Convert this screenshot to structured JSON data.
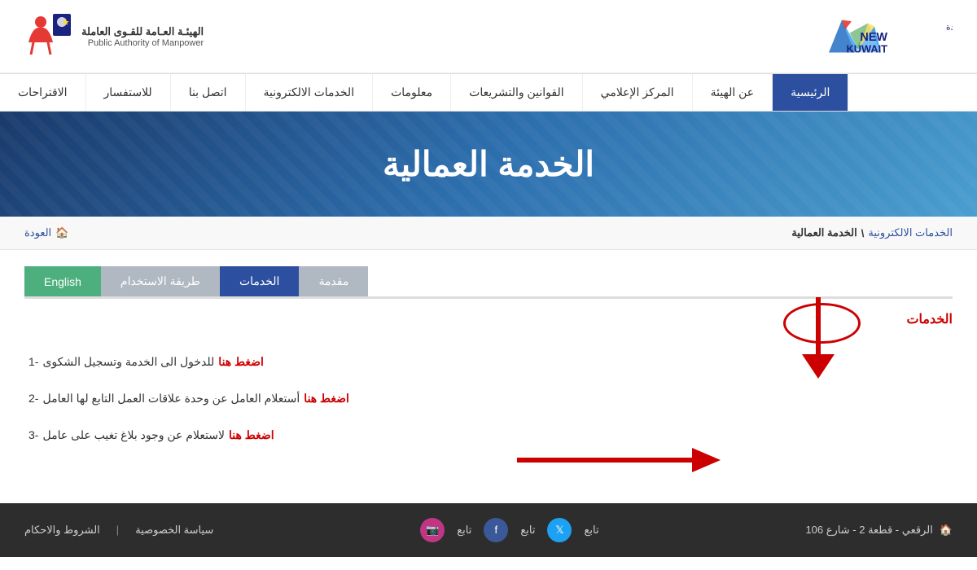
{
  "header": {
    "logo_left_alt": "New Kuwait Logo",
    "logo_right_org_ar": "الهيئـة العـامة للقـوى العاملة",
    "logo_right_org_en": "Public Authority of Manpower"
  },
  "nav": {
    "items": [
      {
        "label": "الرئيسية",
        "active": true
      },
      {
        "label": "عن الهيئة",
        "active": false
      },
      {
        "label": "المركز الإعلامي",
        "active": false
      },
      {
        "label": "القوانين والتشريعات",
        "active": false
      },
      {
        "label": "معلومات",
        "active": false
      },
      {
        "label": "الخدمات الالكترونية",
        "active": false
      },
      {
        "label": "اتصل بنا",
        "active": false
      },
      {
        "label": "للاستفسار",
        "active": false
      },
      {
        "label": "الاقتراحات",
        "active": false
      }
    ]
  },
  "hero": {
    "title": "الخدمة العمالية"
  },
  "breadcrumb": {
    "home_icon": "🏠",
    "back_label": "العودة",
    "items": [
      {
        "label": "الخدمات الالكترونية",
        "link": true
      },
      {
        "label": "الخدمة العمالية",
        "link": false
      }
    ],
    "separator": "\\"
  },
  "tabs": [
    {
      "label": "مقدمة",
      "active": false
    },
    {
      "label": "الخدمات",
      "active": true
    },
    {
      "label": "طريقة الاستخدام",
      "active": false
    },
    {
      "label": "English",
      "active": false,
      "type": "english"
    }
  ],
  "services": {
    "title": "الخدمات",
    "items": [
      {
        "number": "1",
        "text": "للدخول الى الخدمة وتسجيل الشكوى",
        "link_label": "اضغط هنا"
      },
      {
        "number": "2",
        "text": "أستعلام العامل عن وحدة علاقات العمل التابع لها العامل",
        "link_label": "اضغط هنا"
      },
      {
        "number": "3",
        "text": "لاستعلام عن وجود بلاغ تغيب على عامل",
        "link_label": "اضغط هنا"
      }
    ]
  },
  "footer": {
    "links": [
      {
        "label": "سياسة الخصوصية"
      },
      {
        "label": "الشروط والاحكام"
      }
    ],
    "separator": "|",
    "social": [
      {
        "name": "twitter",
        "label": "تابع"
      },
      {
        "name": "facebook",
        "label": "تابع"
      },
      {
        "name": "instagram",
        "label": "تابع"
      }
    ],
    "address_icon": "🏠",
    "address": "الرقعي - قطعة 2 - شارع 106"
  }
}
